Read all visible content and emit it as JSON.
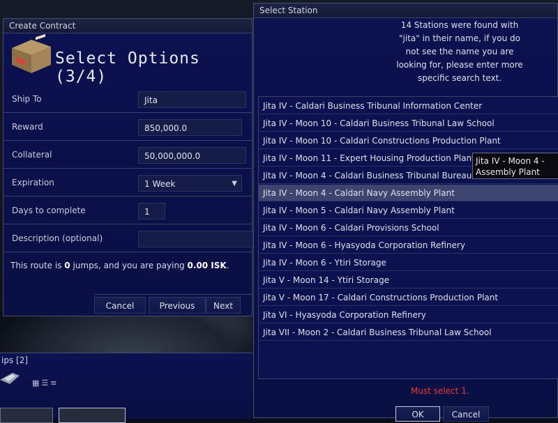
{
  "create_contract": {
    "window_title": "Create Contract",
    "heading": "Select Options (3/4)",
    "fields": {
      "ship_to_label": "Ship To",
      "ship_to_value": "Jita",
      "reward_label": "Reward",
      "reward_value": "850,000.0",
      "collateral_label": "Collateral",
      "collateral_value": "50,000,000.0",
      "expiration_label": "Expiration",
      "expiration_value": "1 Week",
      "days_label": "Days to complete",
      "days_value": "1",
      "description_label": "Description (optional)",
      "description_value": ""
    },
    "route": {
      "prefix": "This route is ",
      "jumps": "0",
      "middle": " jumps, and you are paying ",
      "isk": "0.00 ISK",
      "suffix": "."
    },
    "buttons": {
      "cancel": "Cancel",
      "previous": "Previous",
      "next": "Next"
    }
  },
  "ships_panel": {
    "title": "ips [2]"
  },
  "select_station": {
    "window_title": "Select Station",
    "message_lines": [
      "14 Stations were found with",
      "\"jita\" in their name, if you do",
      "not see the name you are",
      "looking for, please enter more",
      "specific search text."
    ],
    "items": [
      "Jita IV - Caldari Business Tribunal Information Center",
      "Jita IV - Moon 10 - Caldari Business Tribunal Law School",
      "Jita IV - Moon 10 - Caldari Constructions Production Plant",
      "Jita IV - Moon 11 - Expert Housing Production Plant",
      "Jita IV - Moon 4 - Caldari Business Tribunal Bureau Offices",
      "Jita IV - Moon 4 - Caldari Navy Assembly Plant",
      "Jita IV - Moon 5 - Caldari Navy Assembly Plant",
      "Jita IV - Moon 6 - Caldari Provisions School",
      "Jita IV - Moon 6 - Hyasyoda Corporation Refinery",
      "Jita IV - Moon 6 - Ytiri Storage",
      "Jita V - Moon 14 - Ytiri Storage",
      "Jita V - Moon 17 - Caldari Constructions Production Plant",
      "Jita VI - Hyasyoda Corporation Refinery",
      "Jita VII - Moon 2 - Caldari Business Tribunal Law School"
    ],
    "selected_index": 5,
    "tooltip_lines": [
      "Jita IV - Moon 4 -",
      "Assembly Plant"
    ],
    "error": "Must select 1.",
    "buttons": {
      "ok": "OK",
      "cancel": "Cancel"
    }
  },
  "colors": {
    "panel": "#0c1150",
    "selected_row": "#3d4470",
    "error": "#e83a2e"
  }
}
